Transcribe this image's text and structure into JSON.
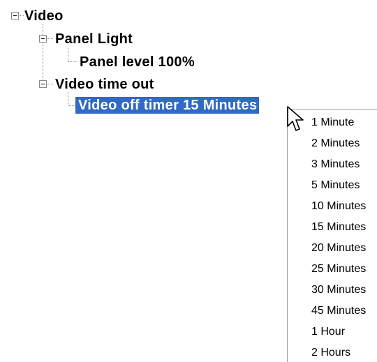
{
  "tree": {
    "video": {
      "label": "Video",
      "expanded": true,
      "icon": "collapse-minus-icon"
    },
    "panel_light": {
      "label": "Panel Light",
      "expanded": true,
      "icon": "collapse-minus-icon"
    },
    "panel_level": {
      "label": "Panel level 100%"
    },
    "video_time_out": {
      "label": "Video time out",
      "expanded": true,
      "icon": "collapse-minus-icon"
    },
    "video_off_timer": {
      "label": "Video off timer 15 Minutes",
      "selected": true
    }
  },
  "dropdown": {
    "options": [
      "1 Minute",
      "2 Minutes",
      "3 Minutes",
      "5 Minutes",
      "10 Minutes",
      "15 Minutes",
      "20 Minutes",
      "25 Minutes",
      "30 Minutes",
      "45 Minutes",
      "1 Hour",
      "2 Hours"
    ]
  },
  "cursor": {
    "icon": "mouse-pointer-icon"
  },
  "colors": {
    "selection_bg": "#316ac5",
    "selection_text": "#ffffff",
    "tree_lines": "#8a8a8a"
  }
}
